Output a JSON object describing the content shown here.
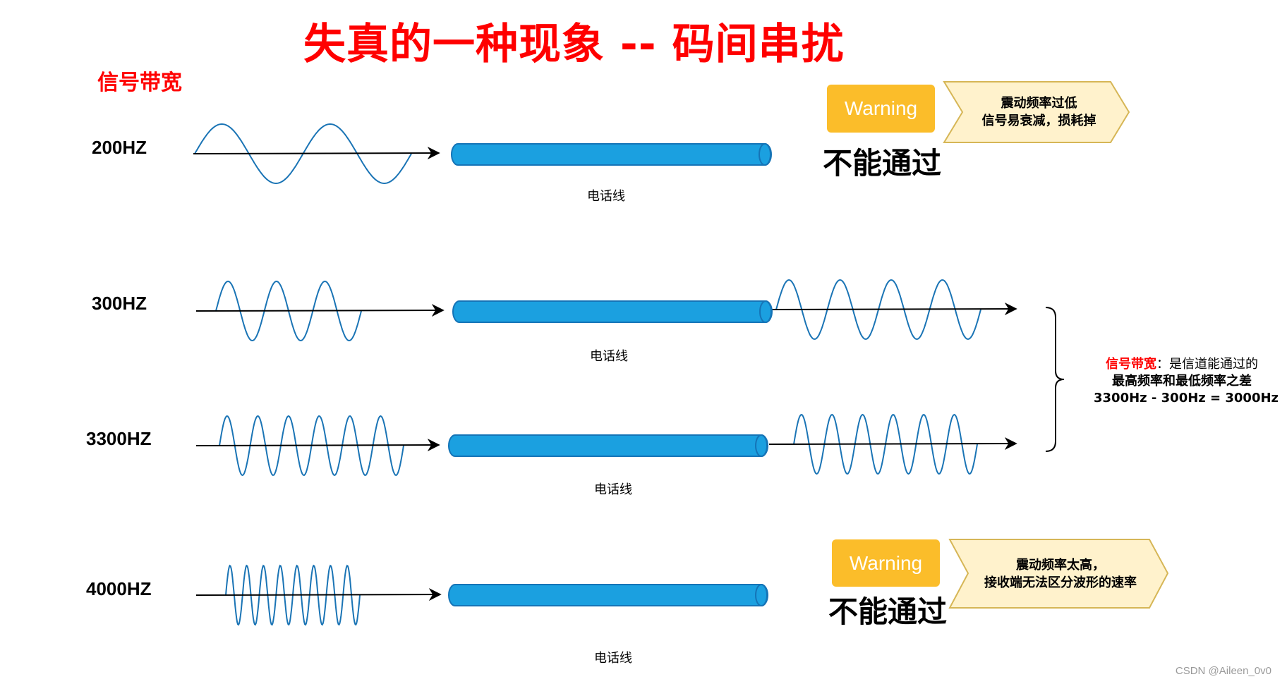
{
  "title": "失真的一种现象 -- 码间串扰",
  "subtitle": "信号带宽",
  "colors": {
    "title": "#ff0000",
    "wave": "#1a74b5",
    "cable_fill": "#1ba0e0",
    "cable_stroke": "#1574b7",
    "warning_fill": "#fbbd2a",
    "callout_fill": "#fff2cc",
    "callout_stroke": "#d6b656"
  },
  "rows": [
    {
      "frequency_label": "200HZ",
      "input_cycles": 2,
      "cable_label": "电话线",
      "passes": false
    },
    {
      "frequency_label": "300HZ",
      "input_cycles": 3,
      "cable_label": "电话线",
      "passes": true,
      "output_cycles": 4
    },
    {
      "frequency_label": "3300HZ",
      "input_cycles": 6,
      "cable_label": "电话线",
      "passes": true,
      "output_cycles": 6
    },
    {
      "frequency_label": "4000HZ",
      "input_cycles": 8,
      "cable_label": "电话线",
      "passes": false
    }
  ],
  "warnings": [
    {
      "badge": "Warning",
      "status": "不能通过",
      "callout_lines": [
        "震动频率过低",
        "信号易衰减，损耗掉"
      ]
    },
    {
      "badge": "Warning",
      "status": "不能通过",
      "callout_lines": [
        "震动频率太高，",
        "接收端无法区分波形的速率"
      ]
    }
  ],
  "bandwidth_note": {
    "term": "信号带宽",
    "rest_line1": "：是信道能通过的",
    "line2": "最高频率和最低频率之差",
    "line3": "3300Hz - 300Hz = 3000Hz"
  },
  "watermark": "CSDN @Aileen_0v0"
}
